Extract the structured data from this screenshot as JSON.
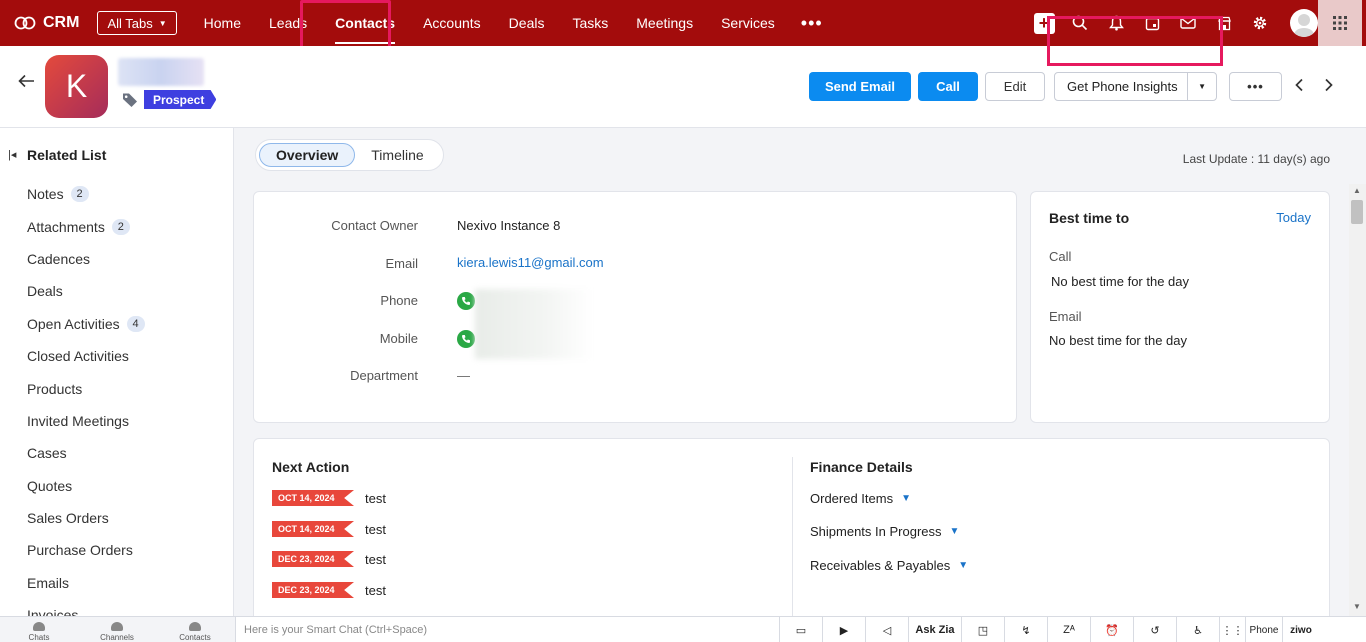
{
  "nav": {
    "brand": "CRM",
    "all_tabs": "All Tabs",
    "tabs": [
      {
        "label": "Home"
      },
      {
        "label": "Leads"
      },
      {
        "label": "Contacts",
        "active": true
      },
      {
        "label": "Accounts"
      },
      {
        "label": "Deals"
      },
      {
        "label": "Tasks"
      },
      {
        "label": "Meetings"
      },
      {
        "label": "Services"
      }
    ],
    "more": "•••",
    "icons": [
      "plus-icon",
      "search-icon",
      "bell-icon",
      "calendar-icon",
      "mail-icon",
      "store-icon",
      "gear-icon",
      "avatar",
      "apps-grid-icon"
    ]
  },
  "record": {
    "initial": "K",
    "tag": "Prospect",
    "buttons": {
      "send_email": "Send Email",
      "call": "Call",
      "edit": "Edit",
      "phone_insights": "Get Phone Insights",
      "more": "•••"
    }
  },
  "sidebar": {
    "title": "Related List",
    "items": [
      {
        "label": "Notes",
        "count": "2"
      },
      {
        "label": "Attachments",
        "count": "2"
      },
      {
        "label": "Cadences",
        "count": ""
      },
      {
        "label": "Deals",
        "count": ""
      },
      {
        "label": "Open Activities",
        "count": "4"
      },
      {
        "label": "Closed Activities",
        "count": ""
      },
      {
        "label": "Products",
        "count": ""
      },
      {
        "label": "Invited Meetings",
        "count": ""
      },
      {
        "label": "Cases",
        "count": ""
      },
      {
        "label": "Quotes",
        "count": ""
      },
      {
        "label": "Sales Orders",
        "count": ""
      },
      {
        "label": "Purchase Orders",
        "count": ""
      },
      {
        "label": "Emails",
        "count": ""
      },
      {
        "label": "Invoices",
        "count": ""
      }
    ]
  },
  "main": {
    "tabs": {
      "overview": "Overview",
      "timeline": "Timeline"
    },
    "last_update": "Last Update : 11 day(s) ago",
    "contact": {
      "owner_label": "Contact Owner",
      "owner_value": "Nexivo Instance 8",
      "email_label": "Email",
      "email_value": "kiera.lewis11@gmail.com",
      "phone_label": "Phone",
      "mobile_label": "Mobile",
      "department_label": "Department",
      "department_value": "—"
    },
    "best_time": {
      "title": "Best time to",
      "today": "Today",
      "call_label": "Call",
      "call_value": "No best time for the day",
      "email_label": "Email",
      "email_value": "No best time for the day"
    },
    "next_action": {
      "title": "Next Action",
      "items": [
        {
          "date": "OCT 14, 2024",
          "text": "test"
        },
        {
          "date": "OCT 14, 2024",
          "text": "test"
        },
        {
          "date": "DEC 23, 2024",
          "text": "test"
        },
        {
          "date": "DEC 23, 2024",
          "text": "test"
        }
      ]
    },
    "finance": {
      "title": "Finance Details",
      "items": [
        "Ordered Items",
        "Shipments In Progress",
        "Receivables & Payables"
      ]
    }
  },
  "bottom": {
    "tabs": [
      "Chats",
      "Channels",
      "Contacts"
    ],
    "smart_chat_placeholder": "Here is your Smart Chat (Ctrl+Space)",
    "ask_zia": "Ask Zia",
    "phone": "Phone",
    "ziwo": "ziwo"
  }
}
